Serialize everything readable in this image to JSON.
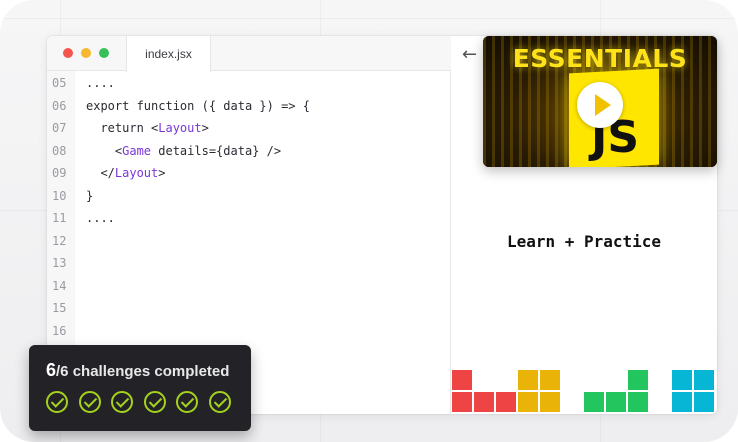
{
  "editor": {
    "tab_label": "index.jsx",
    "lines": [
      {
        "num": "05",
        "text": "...."
      },
      {
        "num": "06",
        "text": "export function ({ data }) => {"
      },
      {
        "num": "07",
        "pre": "  return <",
        "tag": "Layout",
        "post": ">"
      },
      {
        "num": "08",
        "pre": "    <",
        "tag": "Game",
        "post": " details={data} />"
      },
      {
        "num": "09",
        "pre": "  </",
        "tag": "Layout",
        "post": ">"
      },
      {
        "num": "10",
        "text": "}"
      },
      {
        "num": "11",
        "text": "...."
      },
      {
        "num": "12",
        "text": ""
      },
      {
        "num": "13",
        "text": ""
      },
      {
        "num": "14",
        "text": ""
      },
      {
        "num": "15",
        "text": ""
      },
      {
        "num": "16",
        "text": ""
      }
    ]
  },
  "preview": {
    "back_icon": "arrow-left-icon",
    "caption": "Learn + Practice",
    "block_colors": {
      "red": "#ef4444",
      "yellow": "#eab308",
      "green": "#22c55e",
      "cyan": "#06b6d4"
    }
  },
  "thumbnail": {
    "title": "ESSENTIALS",
    "logo_text": "JS",
    "play_icon": "play-icon"
  },
  "badge": {
    "count": "6",
    "rest": "/6 challenges completed",
    "checks_completed": 6,
    "check_color": "#a4d21e"
  }
}
